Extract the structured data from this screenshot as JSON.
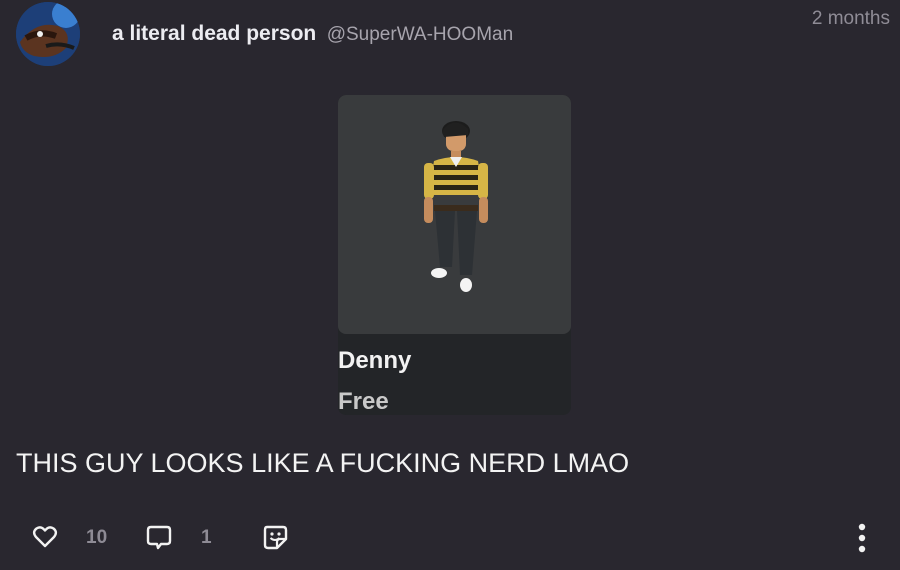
{
  "author": {
    "display_name": "a literal dead person",
    "handle": "@SuperWA-HOOMan",
    "avatar_icon": "avatar-image"
  },
  "timestamp": "2 months",
  "item": {
    "name": "Denny",
    "price": "Free"
  },
  "post_text": "THIS GUY LOOKS LIKE A FUCKING NERD LMAO",
  "actions": {
    "like_icon": "heart-icon",
    "like_count": "10",
    "reply_icon": "comment-icon",
    "reply_count": "1",
    "react_icon": "sticker-icon",
    "more_icon": "more-vertical-icon"
  },
  "colors": {
    "background": "#29272f",
    "text_primary": "#ececf1",
    "text_secondary": "#a7a4ad"
  }
}
